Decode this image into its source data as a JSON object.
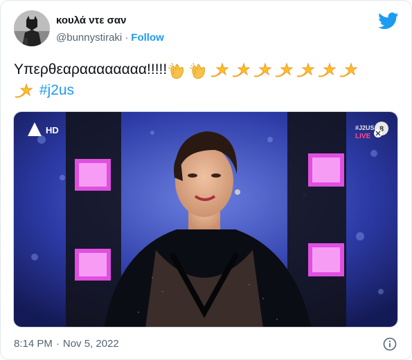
{
  "author": {
    "display_name": "κουλά ντε σαν",
    "handle": "@bunnystiraki",
    "separator": "·",
    "follow_label": "Follow"
  },
  "tweet": {
    "text": "Υπερθεαραααααααα!!!!!",
    "hashtag": "#j2us",
    "emojis": [
      "clapping-hands",
      "clapping-hands",
      "dizzy-star",
      "dizzy-star",
      "dizzy-star",
      "dizzy-star",
      "dizzy-star",
      "dizzy-star",
      "dizzy-star",
      "dizzy-star"
    ]
  },
  "media": {
    "channel_logo_text": "HD",
    "show_tag": "#J2US",
    "live_label": "LIVE",
    "rating_badge": "8"
  },
  "footer": {
    "time": "8:14 PM",
    "separator": "·",
    "date": "Nov 5, 2022"
  },
  "icons": {
    "brand": "twitter-bird-icon",
    "info": "info-icon"
  },
  "colors": {
    "accent": "#1d9bf0",
    "secondary_text": "#536471",
    "primary_text": "#0f1419"
  }
}
